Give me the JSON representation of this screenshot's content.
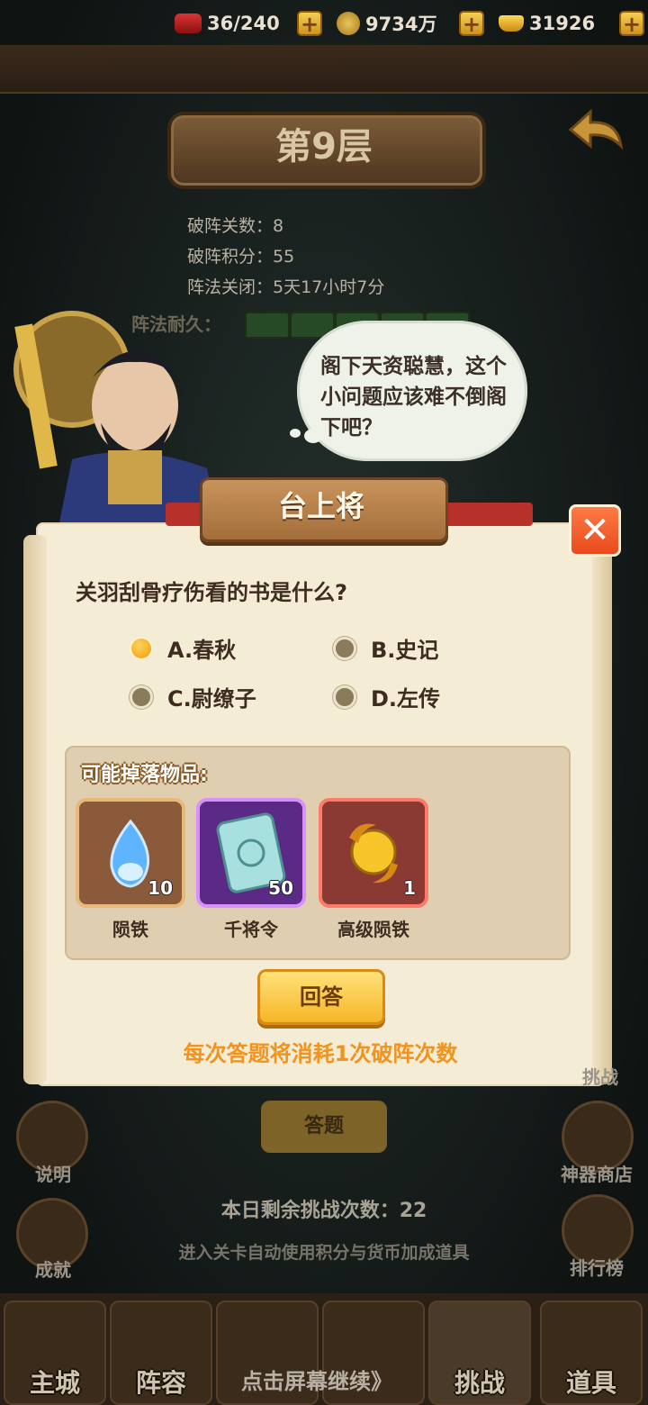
{
  "resources": {
    "stamina": "36/240",
    "coins": "9734万",
    "gold": "31926"
  },
  "floor": {
    "title": "第9层"
  },
  "stats": {
    "cleared": "破阵关数：8",
    "points": "破阵积分：55",
    "closing": "阵法关闭：5天17小时7分",
    "durability_label": "阵法耐久："
  },
  "bubble": {
    "text": "阁下天资聪慧，这个小问题应该难不倒阁下吧？"
  },
  "dialog": {
    "title": "台上将",
    "question": "关羽刮骨疗伤看的书是什么?",
    "options": [
      {
        "label": "A.春秋",
        "selected": true
      },
      {
        "label": "B.史记",
        "selected": false
      },
      {
        "label": "C.尉缭子",
        "selected": false
      },
      {
        "label": "D.左传",
        "selected": false
      }
    ],
    "drops_label": "可能掉落物品:",
    "drops": [
      {
        "name": "陨铁",
        "count": "10",
        "icon": "blue-flame-ore-icon",
        "frame_color": "#b87848"
      },
      {
        "name": "千将令",
        "count": "50",
        "icon": "token-card-icon",
        "frame_color": "#8c3dc8"
      },
      {
        "name": "高级陨铁",
        "count": "1",
        "icon": "golden-orb-icon",
        "frame_color": "#d8443a"
      }
    ],
    "answer_button": "回答",
    "cost_note": "每次答题将消耗1次破阵次数"
  },
  "background": {
    "answer_button": "答题",
    "remaining": "本日剩余挑战次数：22",
    "hint": "进入关卡自动使用积分与货币加成道具",
    "left_buttons": [
      "说明",
      "成就"
    ],
    "right_buttons": [
      "挑战",
      "神器商店",
      "排行榜"
    ]
  },
  "nav": {
    "items": [
      "主城",
      "阵容",
      "",
      "",
      "挑战",
      "道具"
    ],
    "tap_continue": "点击屏幕继续》"
  },
  "colors": {
    "accent": "#f0931f",
    "close": "#e94a1c"
  }
}
